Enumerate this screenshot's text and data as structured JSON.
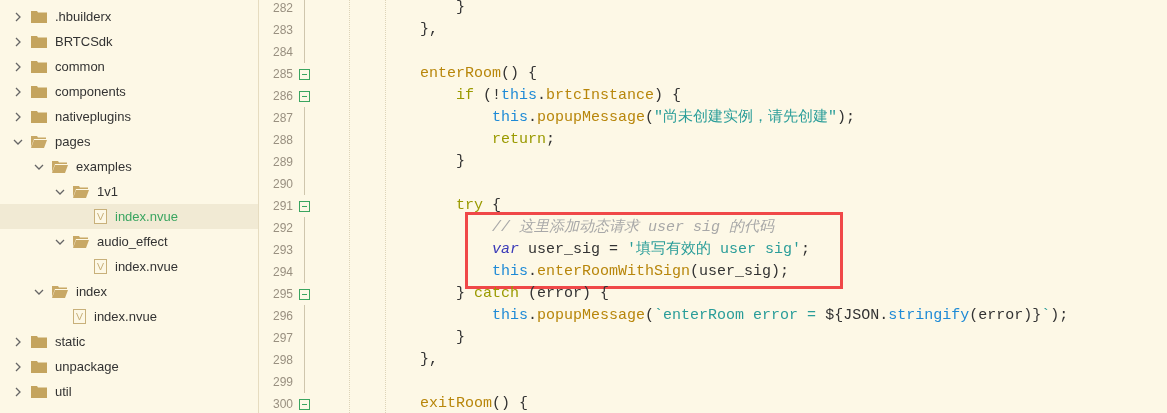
{
  "sidebar": {
    "items": [
      {
        "label": ".hbuilderx",
        "kind": "folder",
        "expanded": false,
        "selected": false
      },
      {
        "label": "BRTCSdk",
        "kind": "folder",
        "expanded": false,
        "selected": false
      },
      {
        "label": "common",
        "kind": "folder",
        "expanded": false,
        "selected": false
      },
      {
        "label": "components",
        "kind": "folder",
        "expanded": false,
        "selected": false
      },
      {
        "label": "nativeplugins",
        "kind": "folder",
        "expanded": false,
        "selected": false
      },
      {
        "label": "pages",
        "kind": "folder",
        "expanded": true,
        "selected": false,
        "children": [
          {
            "label": "examples",
            "kind": "folder",
            "expanded": true,
            "selected": false,
            "children": [
              {
                "label": "1v1",
                "kind": "folder",
                "expanded": true,
                "selected": false,
                "children": [
                  {
                    "label": "index.nvue",
                    "kind": "file",
                    "selected": true
                  }
                ]
              },
              {
                "label": "audio_effect",
                "kind": "folder",
                "expanded": true,
                "selected": false,
                "children": [
                  {
                    "label": "index.nvue",
                    "kind": "file",
                    "selected": false
                  }
                ]
              }
            ]
          },
          {
            "label": "index",
            "kind": "folder",
            "expanded": true,
            "selected": false,
            "children": [
              {
                "label": "index.nvue",
                "kind": "file",
                "selected": false
              }
            ]
          }
        ]
      },
      {
        "label": "static",
        "kind": "folder",
        "expanded": false,
        "selected": false
      },
      {
        "label": "unpackage",
        "kind": "folder",
        "expanded": false,
        "selected": false
      },
      {
        "label": "util",
        "kind": "folder",
        "expanded": false,
        "selected": false
      }
    ]
  },
  "editor": {
    "lines": [
      {
        "number": "282",
        "fold": false,
        "highlighted": false,
        "tokens": [
          {
            "kind": "plain",
            "text": "            }"
          }
        ]
      },
      {
        "number": "283",
        "fold": false,
        "highlighted": false,
        "tokens": [
          {
            "kind": "plain",
            "text": "        },"
          }
        ]
      },
      {
        "number": "284",
        "fold": false,
        "highlighted": false
      },
      {
        "number": "285",
        "fold": true,
        "highlighted": false,
        "tokens": [
          {
            "kind": "func",
            "text": "        enterRoom"
          },
          {
            "kind": "plain",
            "text": "() {"
          }
        ]
      },
      {
        "number": "286",
        "fold": true,
        "highlighted": false,
        "tokens": [
          {
            "kind": "keyword",
            "text": "            if"
          },
          {
            "kind": "plain",
            "text": " (!"
          },
          {
            "kind": "this",
            "text": "this"
          },
          {
            "kind": "plain",
            "text": "."
          },
          {
            "kind": "func",
            "text": "brtcInstance"
          },
          {
            "kind": "plain",
            "text": ") {"
          }
        ]
      },
      {
        "number": "287",
        "fold": false,
        "highlighted": false,
        "tokens": [
          {
            "kind": "this",
            "text": "                this"
          },
          {
            "kind": "plain",
            "text": "."
          },
          {
            "kind": "func",
            "text": "popupMessage"
          },
          {
            "kind": "plain",
            "text": "("
          },
          {
            "kind": "string",
            "text": "\"尚未创建实例，请先创建\""
          },
          {
            "kind": "plain",
            "text": ");"
          }
        ]
      },
      {
        "number": "288",
        "fold": false,
        "highlighted": false,
        "tokens": [
          {
            "kind": "keyword",
            "text": "                return"
          },
          {
            "kind": "plain",
            "text": ";"
          }
        ]
      },
      {
        "number": "289",
        "fold": false,
        "highlighted": false,
        "tokens": [
          {
            "kind": "plain",
            "text": "            }"
          }
        ]
      },
      {
        "number": "290",
        "fold": false,
        "highlighted": false
      },
      {
        "number": "291",
        "fold": true,
        "highlighted": false,
        "tokens": [
          {
            "kind": "keyword",
            "text": "            try"
          },
          {
            "kind": "plain",
            "text": " {"
          }
        ]
      },
      {
        "number": "292",
        "fold": false,
        "highlighted": true,
        "tokens": [
          {
            "kind": "comment",
            "text": "                // 这里添加动态请求 user sig 的代码"
          }
        ]
      },
      {
        "number": "293",
        "fold": false,
        "highlighted": true,
        "tokens": [
          {
            "kind": "var",
            "text": "                var"
          },
          {
            "kind": "plain",
            "text": " user_sig = "
          },
          {
            "kind": "string",
            "text": "'填写有效的 user sig'"
          },
          {
            "kind": "plain",
            "text": ";"
          }
        ]
      },
      {
        "number": "294",
        "fold": false,
        "highlighted": true,
        "tokens": [
          {
            "kind": "this",
            "text": "                this"
          },
          {
            "kind": "plain",
            "text": "."
          },
          {
            "kind": "func",
            "text": "enterRoomWithSign"
          },
          {
            "kind": "plain",
            "text": "(user_sig);"
          }
        ]
      },
      {
        "number": "295",
        "fold": true,
        "highlighted": false,
        "tokens": [
          {
            "kind": "plain",
            "text": "            } "
          },
          {
            "kind": "keyword",
            "text": "catch"
          },
          {
            "kind": "plain",
            "text": " (error) {"
          }
        ]
      },
      {
        "number": "296",
        "fold": false,
        "highlighted": false,
        "tokens": [
          {
            "kind": "this",
            "text": "                this"
          },
          {
            "kind": "plain",
            "text": "."
          },
          {
            "kind": "func",
            "text": "popupMessage"
          },
          {
            "kind": "plain",
            "text": "("
          },
          {
            "kind": "string",
            "text": "`enterRoom error = "
          },
          {
            "kind": "plain",
            "text": "${JSON."
          },
          {
            "kind": "this",
            "text": "stringify"
          },
          {
            "kind": "plain",
            "text": "(error)}"
          },
          {
            "kind": "string",
            "text": "`"
          },
          {
            "kind": "plain",
            "text": ");"
          }
        ]
      },
      {
        "number": "297",
        "fold": false,
        "highlighted": false,
        "tokens": [
          {
            "kind": "plain",
            "text": "            }"
          }
        ]
      },
      {
        "number": "298",
        "fold": false,
        "highlighted": false,
        "tokens": [
          {
            "kind": "plain",
            "text": "        },"
          }
        ]
      },
      {
        "number": "299",
        "fold": false,
        "highlighted": false
      },
      {
        "number": "300",
        "fold": true,
        "highlighted": false,
        "tokens": [
          {
            "kind": "func",
            "text": "        exitRoom"
          },
          {
            "kind": "plain",
            "text": "() {"
          }
        ]
      }
    ]
  }
}
